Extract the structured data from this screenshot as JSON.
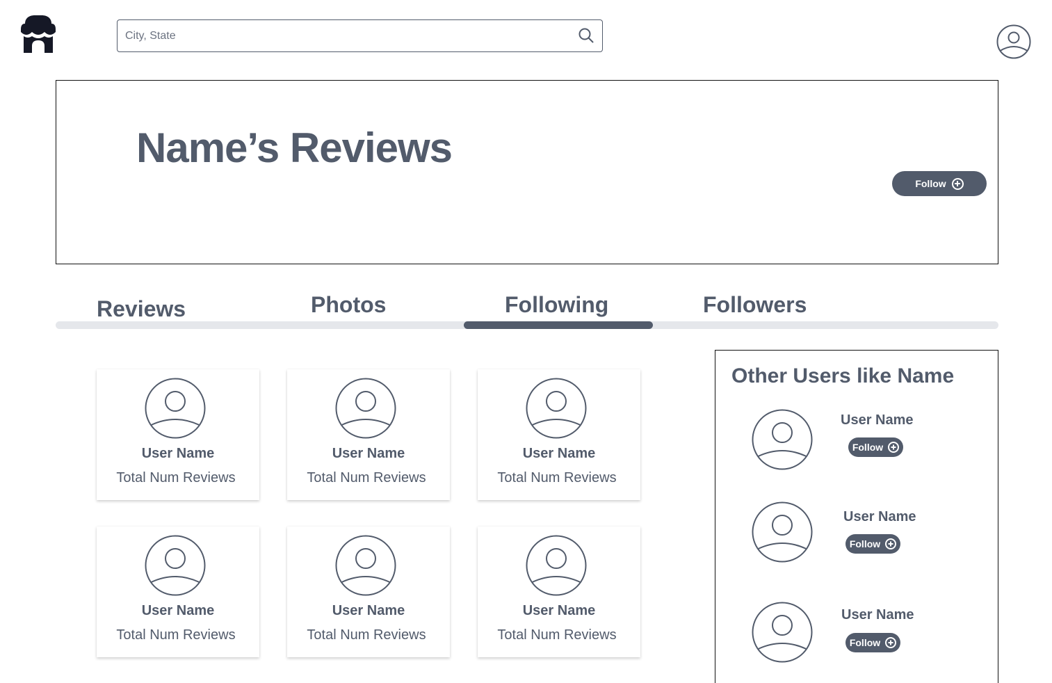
{
  "header": {
    "logo_icon": "storefront-logo-icon",
    "search": {
      "placeholder": "City, State",
      "value": "",
      "icon": "search-icon"
    },
    "account_icon": "user-avatar-icon"
  },
  "profile": {
    "title": "Name’s Reviews",
    "follow_label": "Follow"
  },
  "tabs": [
    {
      "label": "Reviews",
      "active": false
    },
    {
      "label": "Photos",
      "active": false
    },
    {
      "label": "Following",
      "active": true
    },
    {
      "label": "Followers",
      "active": false
    }
  ],
  "following": [
    {
      "name": "User Name",
      "reviews": "Total Num Reviews"
    },
    {
      "name": "User Name",
      "reviews": "Total Num Reviews"
    },
    {
      "name": "User Name",
      "reviews": "Total Num Reviews"
    },
    {
      "name": "User Name",
      "reviews": "Total Num Reviews"
    },
    {
      "name": "User Name",
      "reviews": "Total Num Reviews"
    },
    {
      "name": "User Name",
      "reviews": "Total Num Reviews"
    }
  ],
  "suggestions": {
    "title": "Other Users like Name",
    "users": [
      {
        "name": "User Name",
        "follow_label": "Follow"
      },
      {
        "name": "User Name",
        "follow_label": "Follow"
      },
      {
        "name": "User Name",
        "follow_label": "Follow"
      }
    ]
  },
  "colors": {
    "primary": "#525b6b",
    "track": "#e5e7eb",
    "logo": "#151826"
  }
}
